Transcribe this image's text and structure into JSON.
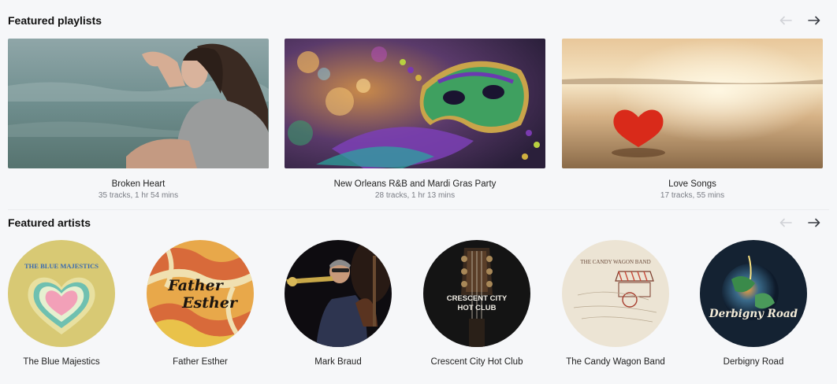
{
  "featured_playlists": {
    "title": "Featured playlists",
    "items": [
      {
        "title": "Broken Heart",
        "meta": "35 tracks, 1 hr 54 mins",
        "icon": "woman-sitting-by-sea-image"
      },
      {
        "title": "New Orleans R&B and Mardi Gras Party",
        "meta": "28 tracks, 1 hr 13 mins",
        "icon": "mardi-gras-mask-image"
      },
      {
        "title": "Love Songs",
        "meta": "17 tracks, 55 mins",
        "icon": "heart-on-beach-image"
      }
    ]
  },
  "featured_artists": {
    "title": "Featured artists",
    "items": [
      {
        "name": "The Blue Majestics",
        "art_text": "THE BLUE MAJESTICS"
      },
      {
        "name": "Father Esther",
        "art_text_1": "Father",
        "art_text_2": "Esther"
      },
      {
        "name": "Mark Braud"
      },
      {
        "name": "Crescent City Hot Club",
        "art_text_1": "CRESCENT CITY",
        "art_text_2": "HOT CLUB"
      },
      {
        "name": "The Candy Wagon Band",
        "art_text": "THE CANDY WAGON BAND"
      },
      {
        "name": "Derbigny Road",
        "art_text": "Derbigny Road"
      }
    ]
  },
  "colors": {
    "background": "#f6f7f9",
    "nav_disabled": "#d0d2d7",
    "nav_active": "#3a3d44"
  }
}
